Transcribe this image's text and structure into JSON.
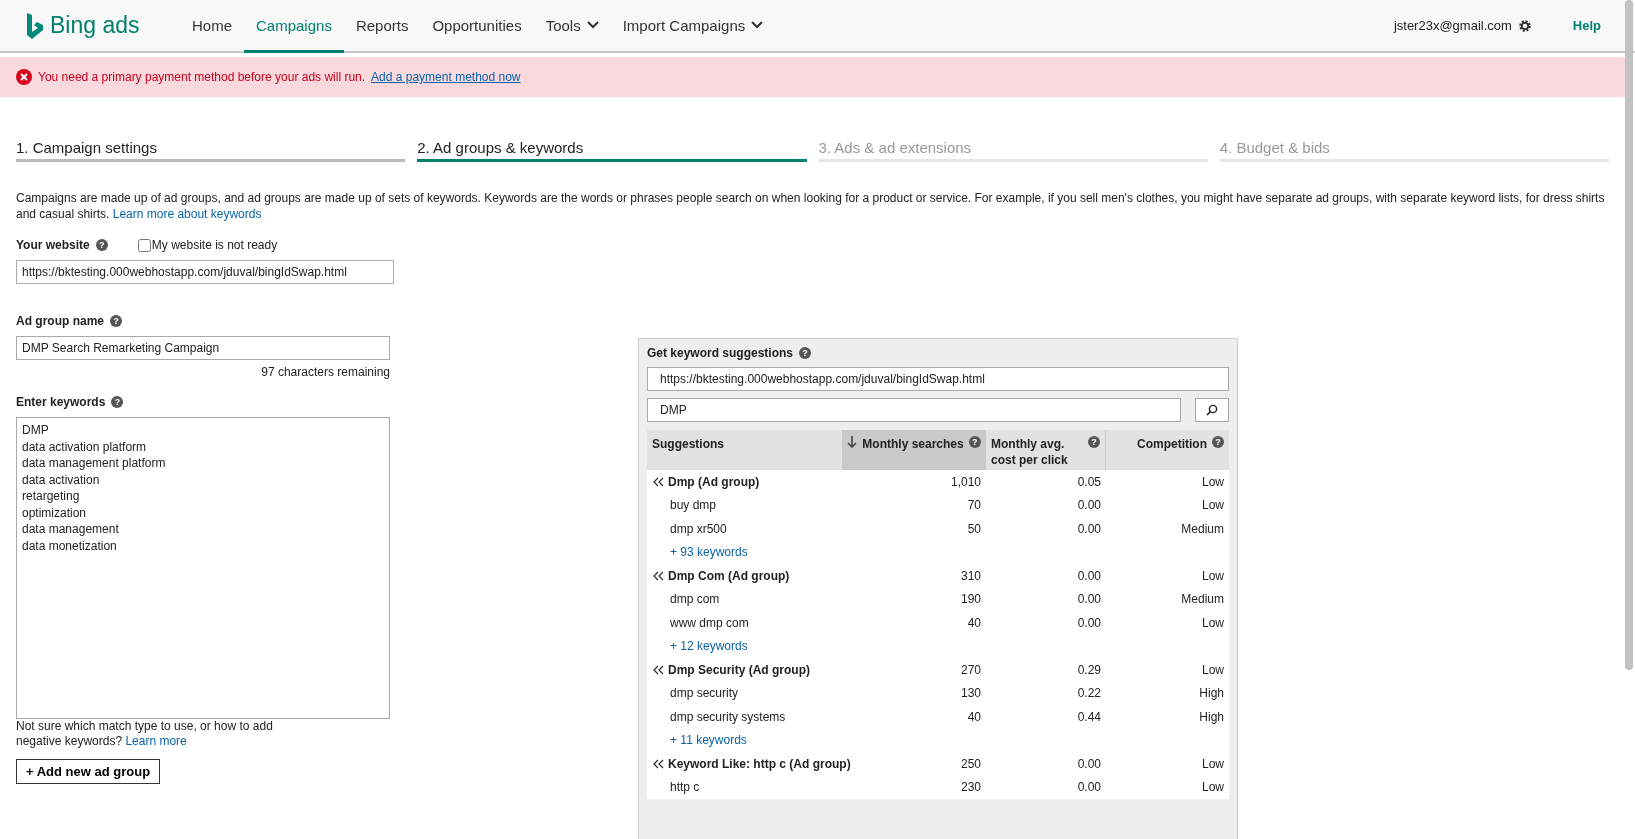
{
  "header": {
    "logo_text": "Bing ads",
    "nav": [
      {
        "label": "Home",
        "selected": false,
        "has_menu": false
      },
      {
        "label": "Campaigns",
        "selected": true,
        "has_menu": false
      },
      {
        "label": "Reports",
        "selected": false,
        "has_menu": false
      },
      {
        "label": "Opportunities",
        "selected": false,
        "has_menu": false
      },
      {
        "label": "Tools",
        "selected": false,
        "has_menu": true
      },
      {
        "label": "Import Campaigns",
        "selected": false,
        "has_menu": true
      }
    ],
    "account": "jster23x@gmail.com",
    "help": "Help"
  },
  "alert": {
    "message": "You need a primary payment method before your ads will run.",
    "link": "Add a payment method now"
  },
  "steps": [
    {
      "label": "1. Campaign settings",
      "selected": false,
      "disabled": false
    },
    {
      "label": "2. Ad groups & keywords",
      "selected": true,
      "disabled": false
    },
    {
      "label": "3. Ads & ad extensions",
      "selected": false,
      "disabled": true
    },
    {
      "label": "4. Budget & bids",
      "selected": false,
      "disabled": true
    }
  ],
  "intro": {
    "text": "Campaigns are made up of ad groups, and ad groups are made up of sets of keywords. Keywords are the words or phrases people search on when looking for a product or service. For example, if you sell men's clothes, you might have separate ad groups, with separate keyword lists, for dress shirts and casual shirts.",
    "link": "Learn more about keywords"
  },
  "website": {
    "label": "Your website",
    "help": "?",
    "not_ready_label": "My website is not ready",
    "not_ready_checked": false,
    "value": "https://bktesting.000webhostapp.com/jduval/bingIdSwap.html"
  },
  "ad_group": {
    "label": "Ad group name",
    "help": "?",
    "value": "DMP Search Remarketing Campaign",
    "remaining": "97 characters remaining"
  },
  "keywords": {
    "label": "Enter keywords",
    "help": "?",
    "values": [
      "DMP",
      "data activation platform",
      "data management platform",
      "data activation",
      "retargeting",
      "optimization",
      "data management",
      "data monetization"
    ],
    "hint": "Not sure which match type to use, or how to add negative keywords?",
    "hint_link": "Learn more"
  },
  "add_button": "+ Add new ad group",
  "suggestions": {
    "title": "Get keyword suggestions",
    "help": "?",
    "url": "https://bktesting.000webhostapp.com/jduval/bingIdSwap.html",
    "query": "DMP",
    "columns": [
      {
        "label": "Suggestions",
        "sorted": false
      },
      {
        "label": "Monthly searches",
        "sorted": true,
        "help": "?"
      },
      {
        "label": "Monthly avg. cost per click",
        "sorted": false,
        "help": "?"
      },
      {
        "label": "Competition",
        "sorted": false,
        "help": "?"
      }
    ],
    "rows": [
      {
        "kind": "group",
        "name": "Dmp (Ad group)",
        "searches": "1,010",
        "cpc": "0.05",
        "competition": "Low"
      },
      {
        "kind": "keyword",
        "name": "buy dmp",
        "searches": "70",
        "cpc": "0.00",
        "competition": "Low"
      },
      {
        "kind": "keyword",
        "name": "dmp xr500",
        "searches": "50",
        "cpc": "0.00",
        "competition": "Medium"
      },
      {
        "kind": "more",
        "name": "+ 93 keywords"
      },
      {
        "kind": "group",
        "name": "Dmp Com (Ad group)",
        "searches": "310",
        "cpc": "0.00",
        "competition": "Low"
      },
      {
        "kind": "keyword",
        "name": "dmp com",
        "searches": "190",
        "cpc": "0.00",
        "competition": "Medium"
      },
      {
        "kind": "keyword",
        "name": "www dmp com",
        "searches": "40",
        "cpc": "0.00",
        "competition": "Low"
      },
      {
        "kind": "more",
        "name": "+ 12 keywords"
      },
      {
        "kind": "group",
        "name": "Dmp Security (Ad group)",
        "searches": "270",
        "cpc": "0.29",
        "competition": "Low"
      },
      {
        "kind": "keyword",
        "name": "dmp security",
        "searches": "130",
        "cpc": "0.22",
        "competition": "High"
      },
      {
        "kind": "keyword",
        "name": "dmp security systems",
        "searches": "40",
        "cpc": "0.44",
        "competition": "High"
      },
      {
        "kind": "more",
        "name": "+ 11 keywords"
      },
      {
        "kind": "group",
        "name": "Keyword Like: http c (Ad group)",
        "searches": "250",
        "cpc": "0.00",
        "competition": "Low"
      },
      {
        "kind": "keyword",
        "name": "http c",
        "searches": "230",
        "cpc": "0.00",
        "competition": "Low"
      }
    ]
  }
}
